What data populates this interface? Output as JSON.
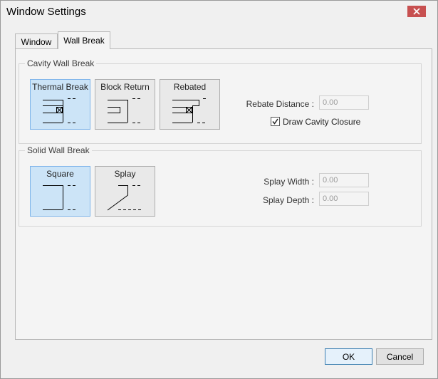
{
  "window": {
    "title": "Window Settings"
  },
  "tabs": [
    {
      "label": "Window",
      "active": false
    },
    {
      "label": "Wall Break",
      "active": true
    }
  ],
  "cavity": {
    "label": "Cavity Wall Break",
    "options": [
      {
        "label": "Thermal Break",
        "selected": true
      },
      {
        "label": "Block Return",
        "selected": false
      },
      {
        "label": "Rebated",
        "selected": false
      }
    ],
    "rebate_distance_label": "Rebate Distance :",
    "rebate_distance_value": "0.00",
    "draw_closure_label": "Draw Cavity Closure",
    "draw_closure_checked": true
  },
  "solid": {
    "label": "Solid Wall Break",
    "options": [
      {
        "label": "Square",
        "selected": true
      },
      {
        "label": "Splay",
        "selected": false
      }
    ],
    "splay_width_label": "Splay Width :",
    "splay_width_value": "0.00",
    "splay_depth_label": "Splay Depth :",
    "splay_depth_value": "0.00"
  },
  "buttons": {
    "ok": "OK",
    "cancel": "Cancel"
  },
  "colors": {
    "selected_fill": "#cce4f7",
    "selected_border": "#7eb4ea",
    "close_red": "#c75050"
  }
}
